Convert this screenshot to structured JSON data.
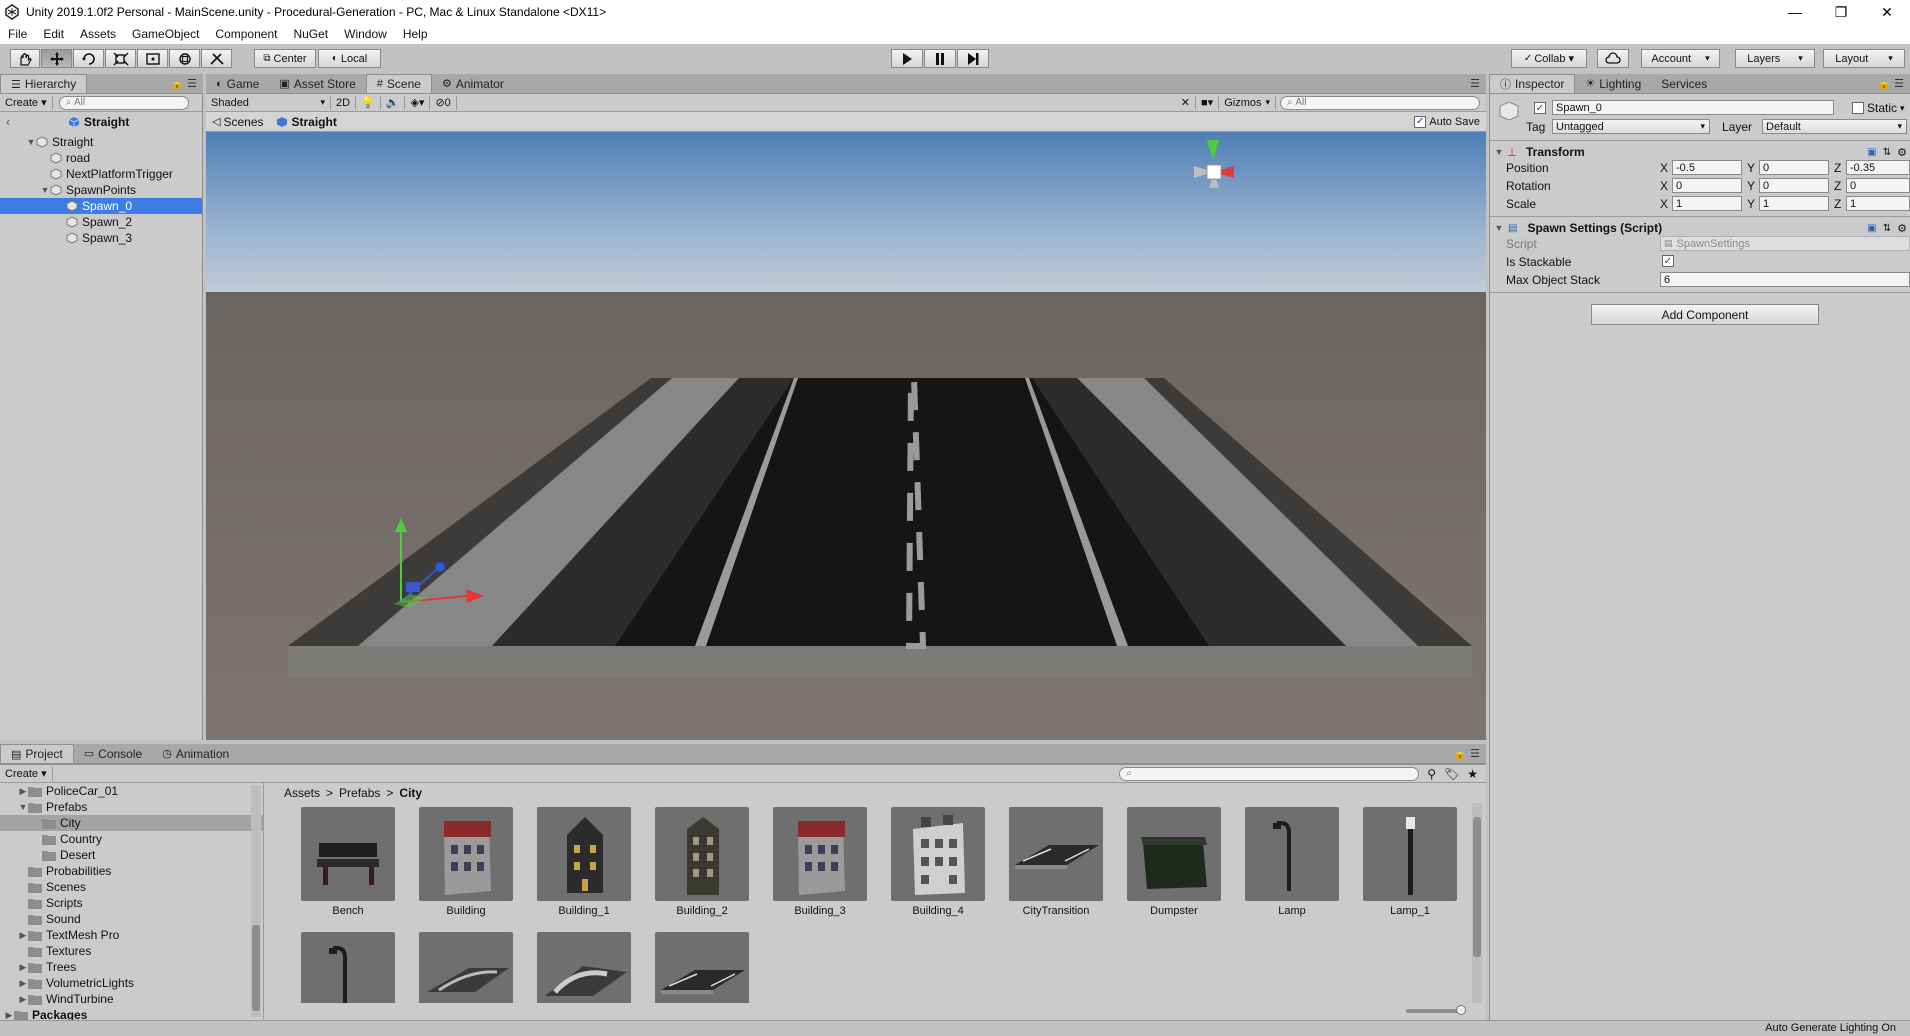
{
  "window": {
    "title": "Unity 2019.1.0f2 Personal - MainScene.unity - Procedural-Generation - PC, Mac & Linux Standalone <DX11>",
    "minimize": "—",
    "restore": "❐",
    "close": "✕"
  },
  "menu": [
    "File",
    "Edit",
    "Assets",
    "GameObject",
    "Component",
    "NuGet",
    "Window",
    "Help"
  ],
  "toolbar": {
    "pivot_label": "Center",
    "space_label": "Local",
    "collab_label": "Collab ▾",
    "account_label": "Account",
    "layers_label": "Layers",
    "layout_label": "Layout",
    "dropdown_arrow": "▾"
  },
  "hierarchy": {
    "tab_label": "Hierarchy",
    "create_label": "Create ▾",
    "search_placeholder": "All",
    "scene_name": "Straight",
    "items": [
      {
        "label": "Straight",
        "foldout": "▼"
      },
      {
        "label": "road",
        "foldout": ""
      },
      {
        "label": "NextPlatformTrigger",
        "foldout": ""
      },
      {
        "label": "SpawnPoints",
        "foldout": "▼"
      },
      {
        "label": "Spawn_0",
        "foldout": ""
      },
      {
        "label": "Spawn_2",
        "foldout": ""
      },
      {
        "label": "Spawn_3",
        "foldout": ""
      }
    ]
  },
  "scene_tabs": {
    "game": "Game",
    "asset_store": "Asset Store",
    "scene": "Scene",
    "animator": "Animator"
  },
  "scene_toolbar": {
    "shading_mode": "Shaded",
    "mode_2d": "2D",
    "hidden_count": "0",
    "gizmos_label": "Gizmos",
    "search_placeholder": "All"
  },
  "scene_breadcrumb": {
    "root": "Scenes",
    "current": "Straight",
    "auto_save_label": "Auto Save"
  },
  "inspector": {
    "tabs": {
      "inspector": "Inspector",
      "lighting": "Lighting",
      "services": "Services"
    },
    "object_name": "Spawn_0",
    "static_label": "Static",
    "tag_label": "Tag",
    "tag_value": "Untagged",
    "layer_label": "Layer",
    "layer_value": "Default",
    "transform": {
      "title": "Transform",
      "position_label": "Position",
      "rotation_label": "Rotation",
      "scale_label": "Scale",
      "axis_x": "X",
      "axis_y": "Y",
      "axis_z": "Z",
      "position": {
        "x": "-0.5",
        "y": "0",
        "z": "-0.35"
      },
      "rotation": {
        "x": "0",
        "y": "0",
        "z": "0"
      },
      "scale": {
        "x": "1",
        "y": "1",
        "z": "1"
      }
    },
    "spawn_settings": {
      "title": "Spawn Settings (Script)",
      "script_label": "Script",
      "script_value": "SpawnSettings",
      "is_stackable_label": "Is Stackable",
      "is_stackable": true,
      "max_stack_label": "Max Object Stack",
      "max_stack_value": "6"
    },
    "add_component_label": "Add Component"
  },
  "project": {
    "tabs": {
      "project": "Project",
      "console": "Console",
      "animation": "Animation"
    },
    "create_label": "Create ▾",
    "folders": [
      {
        "label": "PoliceCar_01",
        "foldout": "▶",
        "level": 1
      },
      {
        "label": "Prefabs",
        "foldout": "▼",
        "level": 1
      },
      {
        "label": "City",
        "foldout": "",
        "level": 2
      },
      {
        "label": "Country",
        "foldout": "",
        "level": 2
      },
      {
        "label": "Desert",
        "foldout": "",
        "level": 2
      },
      {
        "label": "Probabilities",
        "foldout": "",
        "level": 1
      },
      {
        "label": "Scenes",
        "foldout": "",
        "level": 1
      },
      {
        "label": "Scripts",
        "foldout": "",
        "level": 1
      },
      {
        "label": "Sound",
        "foldout": "",
        "level": 1
      },
      {
        "label": "TextMesh Pro",
        "foldout": "▶",
        "level": 1
      },
      {
        "label": "Textures",
        "foldout": "",
        "level": 1
      },
      {
        "label": "Trees",
        "foldout": "▶",
        "level": 1
      },
      {
        "label": "VolumetricLights",
        "foldout": "▶",
        "level": 1
      },
      {
        "label": "WindTurbine",
        "foldout": "▶",
        "level": 1
      },
      {
        "label": "Packages",
        "foldout": "▶",
        "level": 0
      }
    ],
    "breadcrumb": {
      "root": "Assets",
      "mid": "Prefabs",
      "current": "City",
      "sep": ">"
    },
    "assets": [
      {
        "label": "Bench",
        "kind": "bench"
      },
      {
        "label": "Building",
        "kind": "building-red"
      },
      {
        "label": "Building_1",
        "kind": "building-dark"
      },
      {
        "label": "Building_2",
        "kind": "building-tall"
      },
      {
        "label": "Building_3",
        "kind": "building-red"
      },
      {
        "label": "Building_4",
        "kind": "building-white"
      },
      {
        "label": "CityTransition",
        "kind": "road-flat"
      },
      {
        "label": "Dumpster",
        "kind": "dumpster"
      },
      {
        "label": "Lamp",
        "kind": "lamp"
      },
      {
        "label": "Lamp_1",
        "kind": "lamp-post"
      },
      {
        "label": "",
        "kind": "lamp"
      },
      {
        "label": "",
        "kind": "road-curve"
      },
      {
        "label": "",
        "kind": "road-curve2"
      },
      {
        "label": "",
        "kind": "road-flat"
      }
    ]
  },
  "status": {
    "auto_lighting": "Auto Generate Lighting On"
  }
}
